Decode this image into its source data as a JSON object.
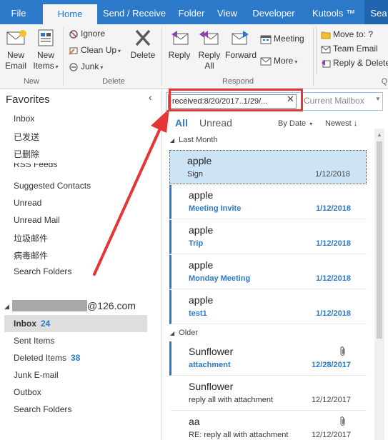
{
  "tabs": [
    "File",
    "Home",
    "Send / Receive",
    "Folder",
    "View",
    "Developer",
    "Kutools ™",
    "Sea"
  ],
  "ribbon": {
    "new": {
      "new_email": [
        "New",
        "Email"
      ],
      "new_items": [
        "New",
        "Items"
      ],
      "group_label": "New"
    },
    "delete": {
      "ignore": "Ignore",
      "clean_up": "Clean Up",
      "junk": "Junk",
      "delete": "Delete",
      "group_label": "Delete"
    },
    "respond": {
      "reply": "Reply",
      "reply_all": [
        "Reply",
        "All"
      ],
      "forward": "Forward",
      "meeting": "Meeting",
      "more": "More",
      "group_label": "Respond"
    },
    "quick_steps": {
      "move_to": "Move to: ?",
      "team_email": "Team Email",
      "reply_delete": "Reply & Delete",
      "group_label": "Q"
    }
  },
  "folders": {
    "favorites_title": "Favorites",
    "favorites": [
      "Inbox",
      "已发送",
      "已删除"
    ],
    "partial_item": "RSS Feeds",
    "items": [
      "Suggested Contacts",
      "Unread",
      "Unread Mail",
      "垃圾邮件",
      "病毒邮件",
      "Search Folders"
    ],
    "account_suffix": "@126.com",
    "account_folders": [
      {
        "name": "Inbox",
        "count": "24",
        "selected": true
      },
      {
        "name": "Sent Items",
        "count": ""
      },
      {
        "name": "Deleted Items",
        "count": "38"
      },
      {
        "name": "Junk E-mail",
        "count": ""
      },
      {
        "name": "Outbox",
        "count": ""
      },
      {
        "name": "Search Folders",
        "count": ""
      }
    ]
  },
  "search": {
    "query": "received:8/20/2017..1/29/...",
    "scope": "Current Mailbox"
  },
  "filters": {
    "all": "All",
    "unread": "Unread",
    "sort_by": "By Date",
    "sort_order": "Newest"
  },
  "groups": {
    "last_month": "Last Month",
    "older": "Older"
  },
  "messages": [
    {
      "from": "apple",
      "subject": "Sign",
      "date": "1/12/2018",
      "unread": false,
      "selected": true,
      "attachment": false
    },
    {
      "from": "apple",
      "subject": "Meeting Invite",
      "date": "1/12/2018",
      "unread": true,
      "selected": false,
      "attachment": false
    },
    {
      "from": "apple",
      "subject": "Trip",
      "date": "1/12/2018",
      "unread": true,
      "selected": false,
      "attachment": false
    },
    {
      "from": "apple",
      "subject": "Monday Meeting",
      "date": "1/12/2018",
      "unread": true,
      "selected": false,
      "attachment": false
    },
    {
      "from": "apple",
      "subject": "test1",
      "date": "1/12/2018",
      "unread": true,
      "selected": false,
      "attachment": false
    },
    {
      "from": "Sunflower",
      "subject": "attachment",
      "date": "12/28/2017",
      "unread": true,
      "selected": false,
      "attachment": true
    },
    {
      "from": "Sunflower",
      "subject": "reply all with attachment",
      "date": "12/12/2017",
      "unread": false,
      "selected": false,
      "attachment": false
    },
    {
      "from": "aa",
      "subject": "RE: reply all with attachment",
      "date": "12/12/2017",
      "unread": false,
      "selected": false,
      "attachment": true
    }
  ],
  "colors": {
    "accent": "#2b79c8",
    "highlight_box": "#e53535",
    "selection": "#cde4f7"
  }
}
